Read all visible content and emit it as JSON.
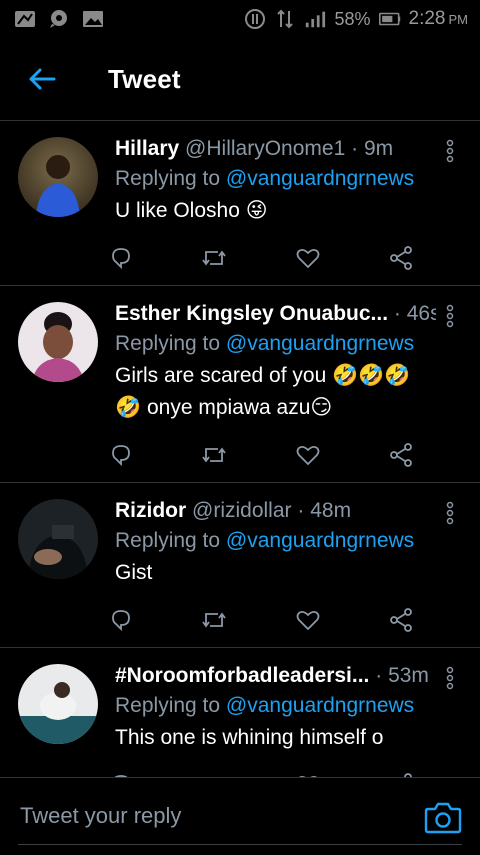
{
  "status_bar": {
    "battery": "58%",
    "time": "2:28",
    "ampm": "PM"
  },
  "header": {
    "title": "Tweet"
  },
  "tweets": [
    {
      "name": "Hillary",
      "handle": "@HillaryOnome1",
      "time": "9m",
      "replying_prefix": "Replying to",
      "replying_to": "@vanguardngrnews",
      "text": "U like Olosho 😜"
    },
    {
      "name": "Esther Kingsley Onuabuc...",
      "handle": "",
      "time": "46s",
      "replying_prefix": "Replying to",
      "replying_to": "@vanguardngrnews",
      "text": "Girls are scared of you 🤣🤣🤣🤣 onye mpiawa azu😏"
    },
    {
      "name": "Rizidor",
      "handle": "@rizidollar",
      "time": "48m",
      "replying_prefix": "Replying to",
      "replying_to": "@vanguardngrnews",
      "text": "Gist"
    },
    {
      "name": "#Noroomforbadleadersi...",
      "handle": "",
      "time": "53m",
      "replying_prefix": "Replying to",
      "replying_to": "@vanguardngrnews",
      "text": "This one is whining himself o"
    }
  ],
  "reply_bar": {
    "placeholder": "Tweet your reply"
  },
  "colors": {
    "accent": "#1da1f2",
    "muted": "#8b98a5",
    "background": "#000000",
    "divider": "#2f3336"
  },
  "icons": [
    "back-arrow-icon",
    "more-vertical-icon",
    "reply-icon",
    "retweet-icon",
    "like-icon",
    "share-icon",
    "camera-icon"
  ]
}
